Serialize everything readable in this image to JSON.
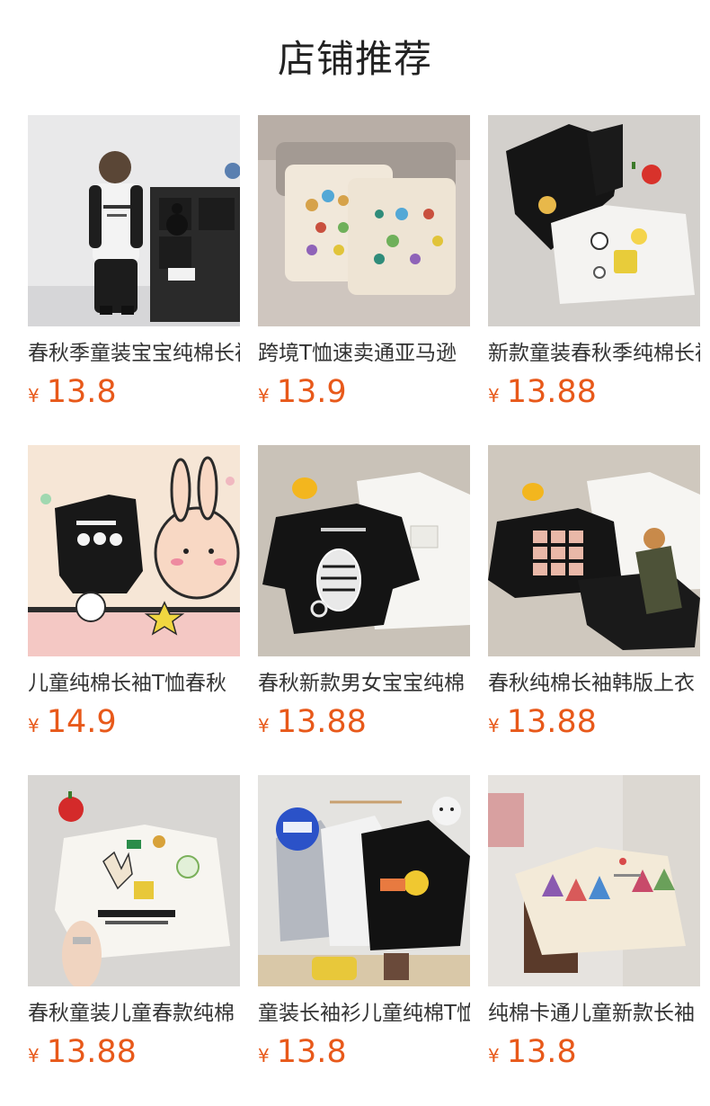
{
  "header": {
    "title": "店铺推荐"
  },
  "colors": {
    "price": "#e8591a",
    "title_text": "#333333",
    "background": "#ffffff"
  },
  "products": [
    {
      "title": "春秋季童装宝宝纯棉长袖T恤",
      "currency": "¥",
      "price": "13.8",
      "image": "boy-raglan-tee-photo"
    },
    {
      "title": "跨境T恤速卖通亚马逊",
      "currency": "¥",
      "price": "13.9",
      "image": "dinosaur-print-tees-photo"
    },
    {
      "title": "新款童装春秋季纯棉长袖",
      "currency": "¥",
      "price": "13.88",
      "image": "spongebob-tees-photo"
    },
    {
      "title": "儿童纯棉长袖T恤春秋",
      "currency": "¥",
      "price": "14.9",
      "image": "cartoon-rabbit-tee-photo"
    },
    {
      "title": "春秋新款男女宝宝纯棉",
      "currency": "¥",
      "price": "13.88",
      "image": "black-white-tees-photo"
    },
    {
      "title": "春秋纯棉长袖韩版上衣",
      "currency": "¥",
      "price": "13.88",
      "image": "black-tee-pants-photo"
    },
    {
      "title": "春秋童装儿童春款纯棉",
      "currency": "¥",
      "price": "13.88",
      "image": "white-sinlauins-tee-photo"
    },
    {
      "title": "童装长袖衫儿童纯棉T恤",
      "currency": "¥",
      "price": "13.8",
      "image": "lets-go-tees-photo"
    },
    {
      "title": "纯棉卡通儿童新款长袖",
      "currency": "¥",
      "price": "13.8",
      "image": "gnome-print-tee-photo"
    }
  ]
}
